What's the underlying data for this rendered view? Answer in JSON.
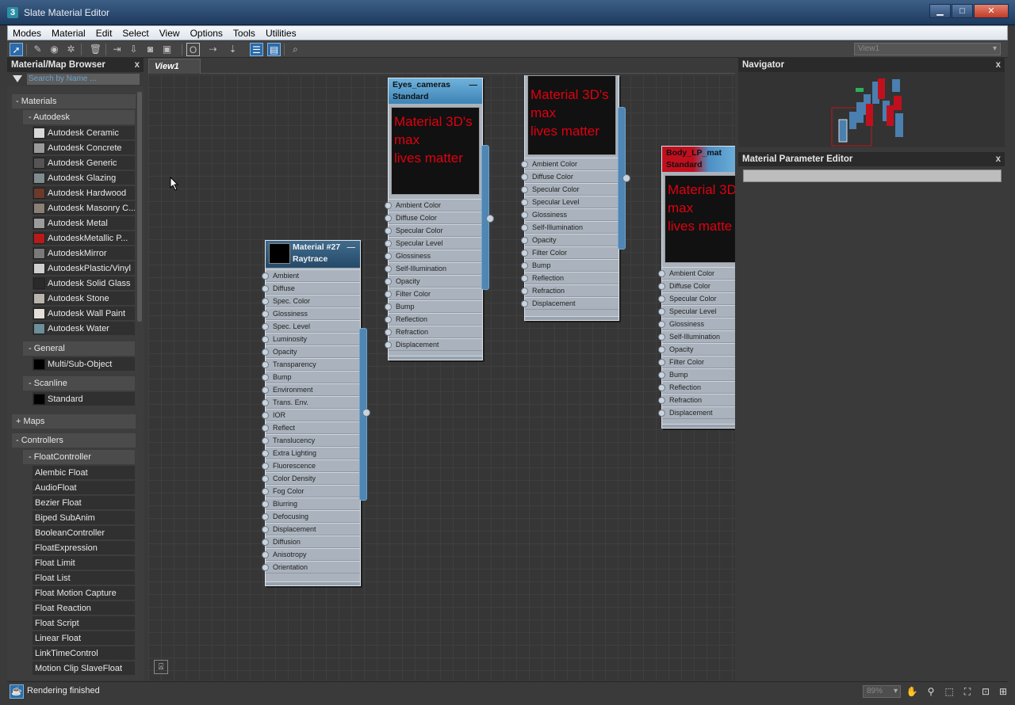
{
  "window": {
    "title": "Slate Material Editor",
    "app_icon": "3"
  },
  "menu": [
    "Modes",
    "Material",
    "Edit",
    "Select",
    "View",
    "Options",
    "Tools",
    "Utilities"
  ],
  "toolbar": {
    "view_select": "View1"
  },
  "browser": {
    "title": "Material/Map Browser",
    "search_placeholder": "Search by Name ...",
    "materials_label": "- Materials",
    "autodesk_label": "- Autodesk",
    "autodesk_items": [
      {
        "label": "Autodesk Ceramic",
        "color": "#d8d8d8"
      },
      {
        "label": "Autodesk Concrete",
        "color": "#9a9a9a"
      },
      {
        "label": "Autodesk Generic",
        "color": "#555555"
      },
      {
        "label": "Autodesk Glazing",
        "color": "#7f8c8f"
      },
      {
        "label": "Autodesk Hardwood",
        "color": "#6b3a2a"
      },
      {
        "label": "Autodesk Masonry C...",
        "color": "#8a8075"
      },
      {
        "label": "Autodesk Metal",
        "color": "#9c9c9c"
      },
      {
        "label": "AutodeskMetallic P...",
        "color": "#b81a1a"
      },
      {
        "label": "AutodeskMirror",
        "color": "#7a7a7a"
      },
      {
        "label": "AutodeskPlastic/Vinyl",
        "color": "#cfcfcf"
      },
      {
        "label": "Autodesk Solid Glass",
        "color": "#2a2a2a"
      },
      {
        "label": "Autodesk Stone",
        "color": "#b9b4ac"
      },
      {
        "label": "Autodesk Wall Paint",
        "color": "#e4e0d8"
      },
      {
        "label": "Autodesk Water",
        "color": "#6c8f9a"
      }
    ],
    "general_label": "- General",
    "general_items": [
      {
        "label": "Multi/Sub-Object",
        "color": "#000000"
      }
    ],
    "scanline_label": "- Scanline",
    "scanline_items": [
      {
        "label": "Standard",
        "color": "#000000"
      }
    ],
    "maps_label": "+ Maps",
    "controllers_label": "- Controllers",
    "floatcontroller_label": "- FloatController",
    "controller_items": [
      "Alembic Float",
      "AudioFloat",
      "Bezier Float",
      "Biped SubAnim",
      "BooleanController",
      "FloatExpression",
      "Float Limit",
      "Float List",
      "Float Motion Capture",
      "Float Reaction",
      "Float Script",
      "Linear Float",
      "LinkTimeControl",
      "Motion Clip SlaveFloat"
    ]
  },
  "view": {
    "tab": "View1"
  },
  "nodes": {
    "raytrace": {
      "name": "Material #27",
      "type": "Raytrace",
      "params": [
        "Ambient",
        "Diffuse",
        "Spec. Color",
        "Glossiness",
        "Spec. Level",
        "Luminosity",
        "Opacity",
        "Transparency",
        "Bump",
        "Environment",
        "Trans. Env.",
        "IOR",
        "Reflect",
        "Translucency",
        "Extra Lighting",
        "Fluorescence",
        "Color Density",
        "Fog Color",
        "Blurring",
        "Defocusing",
        "Displacement",
        "Diffusion",
        "Anisotropy",
        "Orientation"
      ]
    },
    "eyes": {
      "name": "Eyes_cameras",
      "type": "Standard",
      "preview_lines": [
        "Material 3D's",
        "max",
        "lives matter"
      ],
      "params": [
        "Ambient Color",
        "Diffuse Color",
        "Specular Color",
        "Specular Level",
        "Glossiness",
        "Self-Illumination",
        "Opacity",
        "Filter Color",
        "Bump",
        "Reflection",
        "Refraction",
        "Displacement"
      ]
    },
    "third": {
      "preview_lines": [
        "Material 3D's",
        "max",
        "lives matter"
      ],
      "params": [
        "Ambient Color",
        "Diffuse Color",
        "Specular Color",
        "Specular Level",
        "Glossiness",
        "Self-Illumination",
        "Opacity",
        "Filter Color",
        "Bump",
        "Reflection",
        "Refraction",
        "Displacement"
      ]
    },
    "body": {
      "name": "Body_LP_mat",
      "type": "Standard",
      "preview_lines": [
        "Material 3D",
        "max",
        "lives matte"
      ],
      "params": [
        "Ambient Color",
        "Diffuse Color",
        "Specular Color",
        "Specular Level",
        "Glossiness",
        "Self-Illumination",
        "Opacity",
        "Filter Color",
        "Bump",
        "Reflection",
        "Refraction",
        "Displacement"
      ]
    }
  },
  "navigator": {
    "title": "Navigator"
  },
  "param_editor": {
    "title": "Material Parameter Editor"
  },
  "status": {
    "text": "Rendering finished",
    "zoom": "89%"
  },
  "colors": {
    "accent": "#4f86b3",
    "preview_text": "#e00010"
  }
}
